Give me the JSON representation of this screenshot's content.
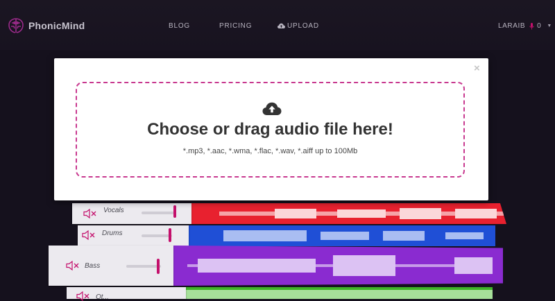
{
  "header": {
    "brand": "PhonicMind",
    "nav": {
      "blog": "BLOG",
      "pricing": "PRICING",
      "upload": "UPLOAD"
    },
    "user": {
      "name": "LARAIB",
      "credits": "0"
    }
  },
  "tracks": [
    {
      "label": "Vocals",
      "color": "#e8212f"
    },
    {
      "label": "Drums",
      "color": "#1f4fd6"
    },
    {
      "label": "Bass",
      "color": "#8a2bd0"
    },
    {
      "label": "Ot...",
      "color": "#3fb428"
    }
  ],
  "modal": {
    "close": "×",
    "title": "Choose or drag audio file here!",
    "formats": "*.mp3, *.aac, *.wma, *.flac, *.wav, *.aiff up to 100Mb"
  },
  "icons": {
    "logo": "brain-logo-icon",
    "upload": "cloud-upload-icon",
    "mic": "microphone-icon",
    "mute": "speaker-mute-icon"
  },
  "colors": {
    "accent": "#c4106c",
    "dropzone_border": "#c8388f",
    "background": "#15111d"
  }
}
